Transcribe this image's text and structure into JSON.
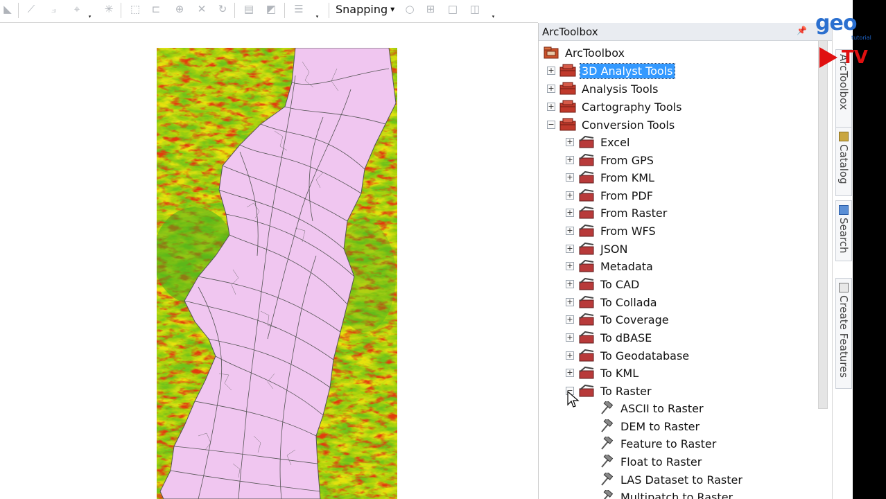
{
  "toolbar": {
    "snapping_label": "Snapping",
    "icons": [
      "edit-vertices-icon",
      "line-icon",
      "curve-icon",
      "trace-icon",
      "midpoint-icon",
      "rotate-icon",
      "reshape-icon",
      "cut-icon",
      "split-icon",
      "redo-icon",
      "table-icon",
      "sketch-properties-icon",
      "attributes-icon"
    ],
    "snap_icons": [
      "point-snap-icon",
      "end-snap-icon",
      "vertex-snap-icon",
      "edge-snap-icon"
    ]
  },
  "panel": {
    "title": "ArcToolbox",
    "root_label": "ArcToolbox",
    "toolboxes": [
      {
        "label": "3D Analyst Tools",
        "selected": true,
        "expanded": false
      },
      {
        "label": "Analysis Tools",
        "selected": false,
        "expanded": false
      },
      {
        "label": "Cartography Tools",
        "selected": false,
        "expanded": false
      },
      {
        "label": "Conversion Tools",
        "selected": false,
        "expanded": true
      }
    ],
    "toolsets": [
      "Excel",
      "From GPS",
      "From KML",
      "From PDF",
      "From Raster",
      "From WFS",
      "JSON",
      "Metadata",
      "To CAD",
      "To Collada",
      "To Coverage",
      "To dBASE",
      "To Geodatabase",
      "To KML",
      "To Raster"
    ],
    "tools": [
      "ASCII to Raster",
      "DEM to Raster",
      "Feature to Raster",
      "Float to Raster",
      "LAS Dataset to Raster",
      "Multipatch to Raster"
    ]
  },
  "side_tabs": [
    "ArcToolbox",
    "Catalog",
    "Search",
    "Create Features"
  ],
  "logo": {
    "brand": "geo",
    "tagline": "tutorial",
    "channel": "TV"
  },
  "colors": {
    "selection": "#3399ff",
    "toolbox_red": "#c0392b",
    "map_polygon": "#f0c6f0",
    "map_green": "#7cc81e",
    "map_yellow": "#e8e000",
    "map_red": "#e02010"
  }
}
